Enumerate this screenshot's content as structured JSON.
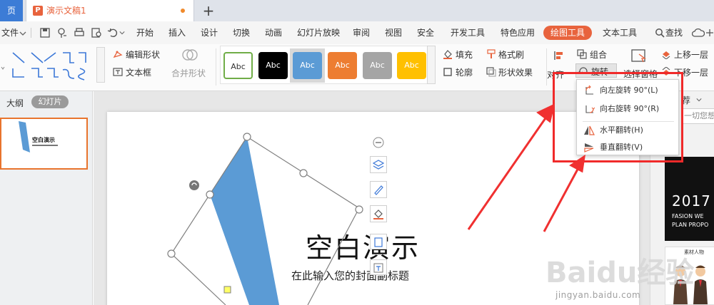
{
  "titlebar": {
    "home_tab": "页",
    "doc_tab_icon": "P",
    "doc_title": "演示文稿1",
    "add_tab": "+"
  },
  "menubar": {
    "file": "文件",
    "tabs": [
      "开始",
      "插入",
      "设计",
      "切换",
      "动画",
      "幻灯片放映",
      "审阅",
      "视图",
      "安全",
      "开发工具",
      "特色应用"
    ],
    "drawing_tools": "绘图工具",
    "text_tools": "文本工具",
    "search": "查找"
  },
  "ribbon": {
    "edit_shape": "编辑形状",
    "text_box": "文本框",
    "merge_shape": "合并形状",
    "style_label": "Abc",
    "fill": "填充",
    "format_painter": "格式刷",
    "outline": "轮廓",
    "shape_effects": "形状效果",
    "group": "组合",
    "align": "对齐",
    "rotate": "旋转",
    "selection_pane": "选择窗格",
    "bring_forward": "上移一层",
    "send_backward": "下移一层"
  },
  "left_panel": {
    "outline_tab": "大纲",
    "slides_tab": "幻灯片",
    "thumb_title": "空白演示"
  },
  "slide": {
    "title": "空白演示",
    "subtitle": "在此输入您的封面副标题"
  },
  "right_panel": {
    "tab": "荐",
    "search_placeholder": "一切您想",
    "template_year": "2017",
    "template_line1": "FASION WE",
    "template_line2": "PLAN PROPO",
    "template2_title": "素材人物"
  },
  "rotate_menu": {
    "items": [
      {
        "label": "向左旋转 90°(L)",
        "icon": "rotate-left-icon"
      },
      {
        "label": "向右旋转 90°(R)",
        "icon": "rotate-right-icon"
      },
      {
        "label": "水平翻转(H)",
        "icon": "flip-horizontal-icon"
      },
      {
        "label": "垂直翻转(V)",
        "icon": "flip-vertical-icon"
      }
    ]
  },
  "watermark": {
    "brand": "Baidu经验",
    "url": "jingyan.baidu.com"
  },
  "colors": {
    "accent": "#e8633d",
    "annotation": "#f02a2a",
    "shape_fill": "#5b9bd5",
    "style_swatches": [
      "#ffffff",
      "#000000",
      "#5b9bd5",
      "#ed7d31",
      "#a5a5a5",
      "#ffc000"
    ]
  }
}
